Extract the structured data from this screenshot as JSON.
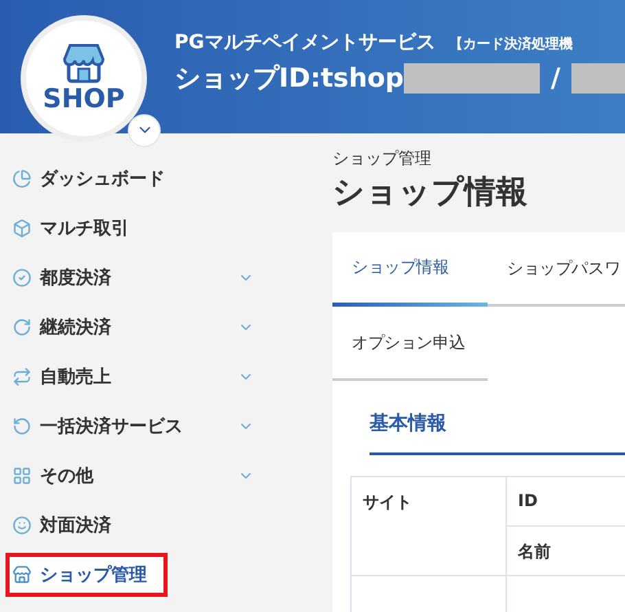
{
  "header": {
    "logo_text": "SHOP",
    "service_name": "PGマルチペイメントサービス",
    "service_note": "【カード決済処理機",
    "shop_id_label": "ショップID:tshop",
    "separator": "/"
  },
  "sidebar": {
    "items": [
      {
        "label": "ダッシュボード",
        "expandable": false,
        "selected": false,
        "annotated": false
      },
      {
        "label": "マルチ取引",
        "expandable": false,
        "selected": false,
        "annotated": false
      },
      {
        "label": "都度決済",
        "expandable": true,
        "selected": false,
        "annotated": false
      },
      {
        "label": "継続決済",
        "expandable": true,
        "selected": false,
        "annotated": false
      },
      {
        "label": "自動売上",
        "expandable": true,
        "selected": false,
        "annotated": false
      },
      {
        "label": "一括決済サービス",
        "expandable": true,
        "selected": false,
        "annotated": false
      },
      {
        "label": "その他",
        "expandable": true,
        "selected": false,
        "annotated": false
      },
      {
        "label": "対面決済",
        "expandable": false,
        "selected": false,
        "annotated": false
      },
      {
        "label": "ショップ管理",
        "expandable": false,
        "selected": true,
        "annotated": true
      }
    ]
  },
  "page": {
    "breadcrumb": "ショップ管理",
    "title": "ショップ情報"
  },
  "tabs": [
    {
      "label": "ショップ情報",
      "selected": true
    },
    {
      "label": "ショップパスワ",
      "selected": false
    },
    {
      "label": "オプション申込",
      "selected": false
    }
  ],
  "section": {
    "title": "基本情報"
  },
  "table": {
    "rows": [
      {
        "group": "サイト",
        "fields": [
          "ID",
          "名前"
        ]
      }
    ]
  }
}
